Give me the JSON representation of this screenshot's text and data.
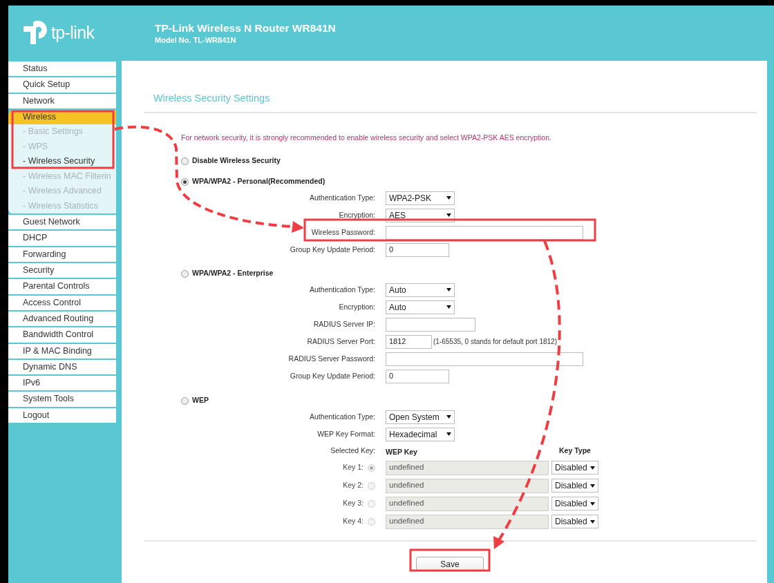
{
  "header": {
    "logo_text": "tp-link",
    "title": "TP-Link Wireless N Router WR841N",
    "model": "Model No. TL-WR841N"
  },
  "sidebar": {
    "items": [
      {
        "label": "Status",
        "selected": false
      },
      {
        "label": "Quick Setup",
        "selected": false
      },
      {
        "label": "Network",
        "selected": false
      },
      {
        "label": "Wireless",
        "selected": true,
        "children": [
          {
            "label": "- Basic Settings",
            "selected": false
          },
          {
            "label": "- WPS",
            "selected": false
          },
          {
            "label": "- Wireless Security",
            "selected": true
          },
          {
            "label": "- Wireless MAC Filterin",
            "selected": false
          },
          {
            "label": "- Wireless Advanced",
            "selected": false
          },
          {
            "label": "- Wireless Statistics",
            "selected": false
          }
        ]
      },
      {
        "label": "Guest Network",
        "selected": false
      },
      {
        "label": "DHCP",
        "selected": false
      },
      {
        "label": "Forwarding",
        "selected": false
      },
      {
        "label": "Security",
        "selected": false
      },
      {
        "label": "Parental Controls",
        "selected": false
      },
      {
        "label": "Access Control",
        "selected": false
      },
      {
        "label": "Advanced Routing",
        "selected": false
      },
      {
        "label": "Bandwidth Control",
        "selected": false
      },
      {
        "label": "IP & MAC Binding",
        "selected": false
      },
      {
        "label": "Dynamic DNS",
        "selected": false
      },
      {
        "label": "IPv6",
        "selected": false
      },
      {
        "label": "System Tools",
        "selected": false
      },
      {
        "label": "Logout",
        "selected": false
      }
    ]
  },
  "page_title": "Wireless Security Settings",
  "notice": "For network security, it is strongly recommended to enable wireless security and select WPA2-PSK AES encryption.",
  "modes": [
    {
      "label": "Disable Wireless Security",
      "selected": false
    },
    {
      "label": "WPA/WPA2 - Personal(Recommended)",
      "selected": true,
      "fields": [
        {
          "kind": "select",
          "label": "Authentication Type:",
          "value": "WPA2-PSK"
        },
        {
          "kind": "select",
          "label": "Encryption:",
          "value": "AES"
        },
        {
          "kind": "input",
          "label": "Wireless Password:"
        },
        {
          "kind": "input",
          "label": "Group Key Update Period:",
          "value": "0"
        }
      ]
    },
    {
      "label": "WPA/WPA2 - Enterprise",
      "selected": false,
      "fields": [
        {
          "kind": "select",
          "label": "Authentication Type:",
          "value": "Auto"
        },
        {
          "kind": "select",
          "label": "Encryption:",
          "value": "Auto"
        },
        {
          "kind": "input",
          "label": "RADIUS Server IP:"
        },
        {
          "kind": "input",
          "label": "RADIUS Server Port:",
          "value": "1812",
          "hint": "(1-65535, 0 stands for default port 1812)"
        },
        {
          "kind": "input",
          "label": "RADIUS Server Password:"
        },
        {
          "kind": "input",
          "label": "Group Key Update Period:",
          "value": "0"
        }
      ]
    },
    {
      "label": "WEP",
      "selected": false,
      "fields": [
        {
          "kind": "select",
          "label": "Authentication Type:",
          "value": "Open System"
        },
        {
          "kind": "select",
          "label": "WEP Key Format:",
          "value": "Hexadecimal"
        }
      ],
      "key_table": {
        "selected_key_label": "Selected Key:",
        "key_column": "WEP Key",
        "type_column": "Key Type",
        "keys": [
          {
            "label": "Key 1:",
            "selected": true,
            "value": "undefined",
            "type": "Disabled"
          },
          {
            "label": "Key 2:",
            "selected": false,
            "value": "undefined",
            "type": "Disabled"
          },
          {
            "label": "Key 3:",
            "selected": false,
            "value": "undefined",
            "type": "Disabled"
          },
          {
            "label": "Key 4:",
            "selected": false,
            "value": "undefined",
            "type": "Disabled"
          }
        ]
      }
    }
  ],
  "save_button": "Save"
}
